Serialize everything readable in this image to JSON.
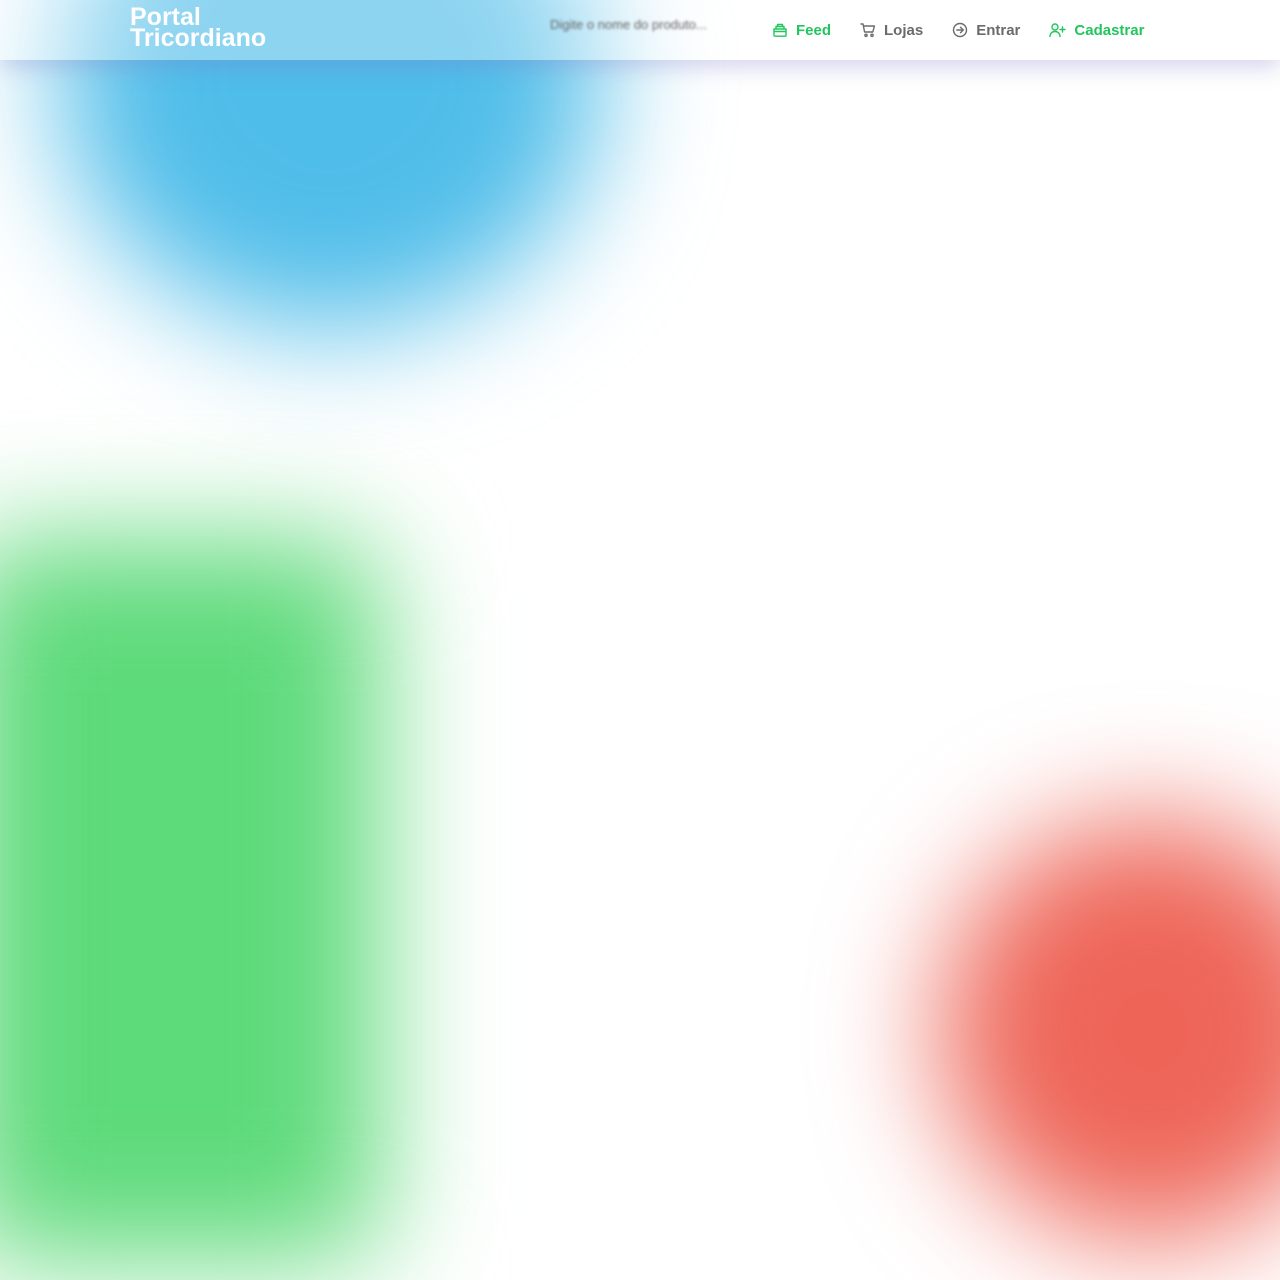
{
  "brand": {
    "line1": "Portal",
    "line2": "Tricordiano"
  },
  "search": {
    "placeholder": "Digite o nome do produto..."
  },
  "nav": {
    "feed": "Feed",
    "lojas": "Lojas",
    "entrar": "Entrar",
    "cadastrar": "Cadastrar"
  },
  "colors": {
    "accent_green": "#22c55e",
    "nav_gray": "#6b6b6b",
    "blob_blue": "#4fbde9",
    "blob_green": "#5dda7a",
    "blob_red": "#ee6558"
  },
  "icons": {
    "feed": "basket-icon",
    "lojas": "cart-icon",
    "entrar": "arrow-circle-right-icon",
    "cadastrar": "user-plus-icon"
  }
}
